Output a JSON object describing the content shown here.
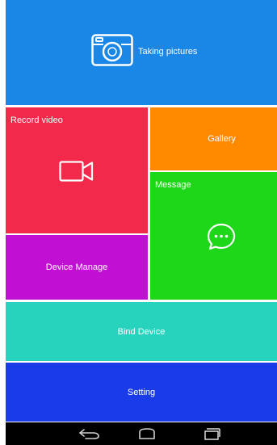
{
  "tiles": {
    "camera": {
      "label": "Taking pictures",
      "color": "#1a86e6",
      "icon": "camera-icon"
    },
    "record": {
      "label": "Record video",
      "color": "#f2294a",
      "icon": "video-camera-icon"
    },
    "gallery": {
      "label": "Gallery",
      "color": "#ff8a00",
      "icon": ""
    },
    "message": {
      "label": "Message",
      "color": "#1ed719",
      "icon": "chat-bubble-icon"
    },
    "device": {
      "label": "Device Manage",
      "color": "#c011d3",
      "icon": ""
    },
    "bind": {
      "label": "Bind Device",
      "color": "#27d3bd",
      "icon": ""
    },
    "setting": {
      "label": "Setting",
      "color": "#1a3be8",
      "icon": ""
    }
  },
  "navbar": {
    "buttons": [
      "back-icon",
      "home-icon",
      "recent-apps-icon"
    ],
    "color": "#000000"
  }
}
